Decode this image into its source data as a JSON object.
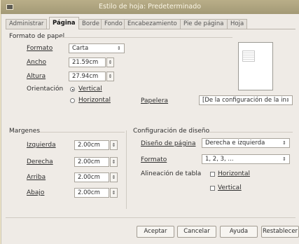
{
  "window": {
    "title": "Estilo de hoja: Predeterminado"
  },
  "tabs": [
    {
      "label": "Administrar"
    },
    {
      "label": "Página"
    },
    {
      "label": "Borde"
    },
    {
      "label": "Fondo"
    },
    {
      "label": "Encabezamiento"
    },
    {
      "label": "Pie de página"
    },
    {
      "label": "Hoja"
    }
  ],
  "paper": {
    "section_label": "Formato de papel",
    "format_label": "Formato",
    "format_value": "Carta",
    "width_label": "Ancho",
    "width_value": "21.59cm",
    "height_label": "Altura",
    "height_value": "27.94cm",
    "orientation_label": "Orientación",
    "vertical_label": "Vertical",
    "horizontal_label": "Horizontal",
    "tray_label": "Papelera",
    "tray_value": "[De la configuración de la in"
  },
  "margins": {
    "section_label": "Margenes",
    "left_label": "Izquierda",
    "left_value": "2.00cm",
    "right_label": "Derecha",
    "right_value": "2.00cm",
    "top_label": "Arriba",
    "top_value": "2.00cm",
    "bottom_label": "Abajo",
    "bottom_value": "2.00cm"
  },
  "layout": {
    "section_label": "Configuración de diseño",
    "page_layout_label": "Diseño de página",
    "page_layout_value": "Derecha e izquierda",
    "format_label": "Formato",
    "format_value": "1, 2, 3, ...",
    "table_align_label": "Alineación de tabla",
    "horizontal_label": "Horizontal",
    "vertical_label": "Vertical"
  },
  "buttons": {
    "ok": "Aceptar",
    "cancel": "Cancelar",
    "help": "Ayuda",
    "reset": "Restablecer"
  },
  "colors": {
    "titlebar": "#a39976",
    "dialog_bg": "#efebe6",
    "desktop": "#f2e7c6"
  }
}
